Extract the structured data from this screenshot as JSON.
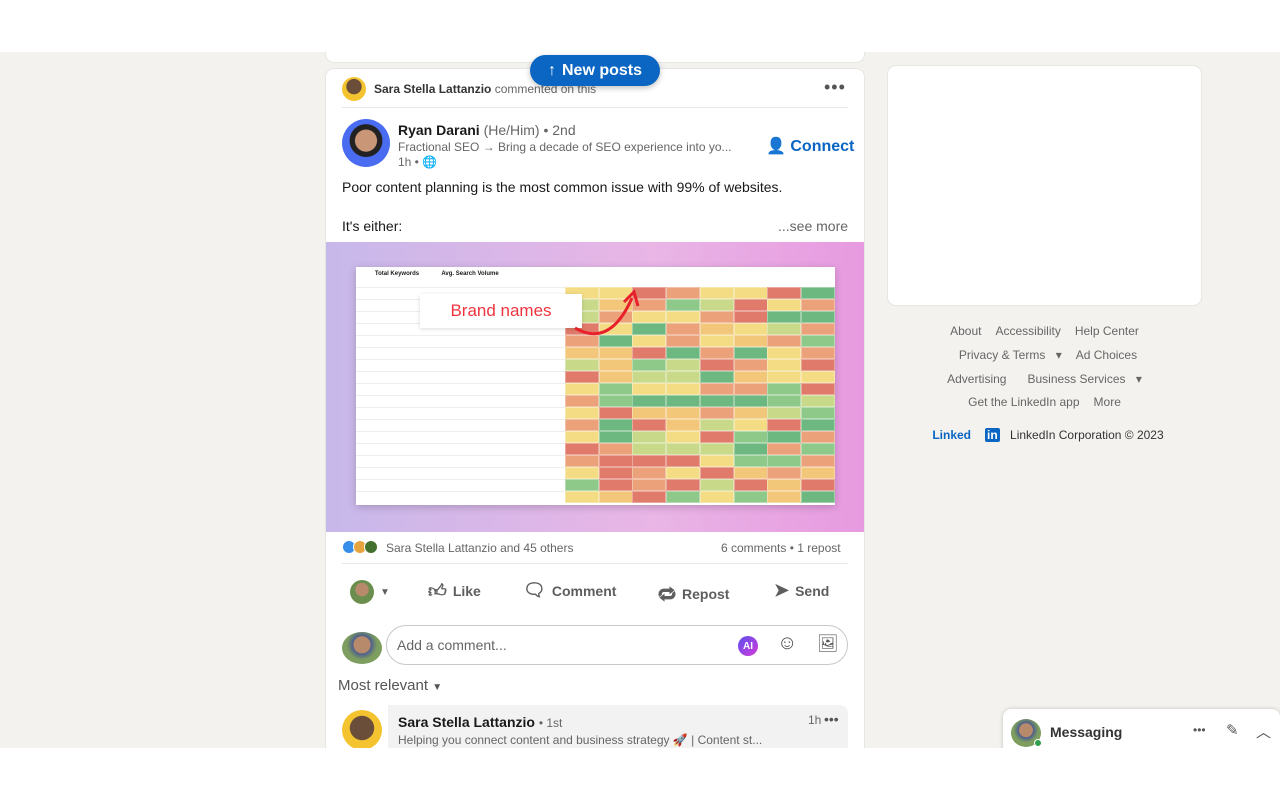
{
  "new_posts": {
    "label": "New posts",
    "icon": "arrow-up-icon"
  },
  "post": {
    "activity": {
      "name": "Sara Stella Lattanzio",
      "action": "commented on this"
    },
    "author": {
      "name": "Ryan Darani",
      "pronouns": "(He/Him)",
      "degree": "• 2nd",
      "headline": "Fractional SEO → Bring a decade of SEO experience into yo...",
      "time": "1h •"
    },
    "connect_label": "Connect",
    "text_line1": "Poor content planning is the most common issue with 99% of websites.",
    "text_line2": "It's either:",
    "see_more": "...see more",
    "image": {
      "callout": "Brand names",
      "headers": [
        "Total Keywords",
        "Avg. Search Volume"
      ]
    },
    "reactions": "Sara Stella Lattanzio and 45 others",
    "counts": "6 comments • 1 repost",
    "actions": {
      "like": "Like",
      "comment": "Comment",
      "repost": "Repost",
      "send": "Send"
    },
    "comment_placeholder": "Add a comment...",
    "ai_badge": "AI",
    "sort": "Most relevant",
    "comment": {
      "name": "Sara Stella Lattanzio",
      "degree": "• 1st",
      "headline": "Helping you connect content and business strategy 🚀 | Content st...",
      "time": "1h"
    }
  },
  "footer": {
    "links": [
      "About",
      "Accessibility",
      "Help Center",
      "Privacy & Terms",
      "Ad Choices",
      "Advertising",
      "Business Services",
      "Get the LinkedIn app",
      "More"
    ],
    "logo": "Linked",
    "copyright": "LinkedIn Corporation © 2023"
  },
  "messaging": {
    "label": "Messaging"
  },
  "colors": {
    "brand": "#0a66c2",
    "bg": "#f3f2ef"
  }
}
